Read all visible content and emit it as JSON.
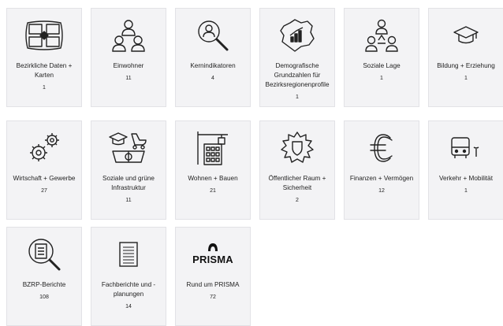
{
  "tiles": [
    {
      "label": "Bezirkliche Daten + Karten",
      "count": "1",
      "icon": "map-icon"
    },
    {
      "label": "Einwohner",
      "count": "11",
      "icon": "people-group-icon"
    },
    {
      "label": "Kernindikatoren",
      "count": "4",
      "icon": "person-search-icon"
    },
    {
      "label": "Demografische Grundzahlen für Bezirksregionenprofile",
      "count": "1",
      "icon": "district-chart-icon"
    },
    {
      "label": "Soziale Lage",
      "count": "1",
      "icon": "social-network-icon"
    },
    {
      "label": "Bildung + Erziehung",
      "count": "1",
      "icon": "graduation-cap-icon"
    },
    {
      "label": "Wirtschaft + Gewerbe",
      "count": "27",
      "icon": "gears-icon"
    },
    {
      "label": "Soziale und grüne Infrastruktur",
      "count": "11",
      "icon": "infrastructure-icon"
    },
    {
      "label": "Wohnen + Bauen",
      "count": "21",
      "icon": "building-icon"
    },
    {
      "label": "Öffentlicher Raum + Sicherheit",
      "count": "2",
      "icon": "shield-badge-icon"
    },
    {
      "label": "Finanzen + Vermögen",
      "count": "12",
      "icon": "euro-icon"
    },
    {
      "label": "Verkehr + Mobilität",
      "count": "1",
      "icon": "bus-icon"
    },
    {
      "label": "BZRP-Berichte",
      "count": "108",
      "icon": "document-search-icon"
    },
    {
      "label": "Fachberichte und -planungen",
      "count": "14",
      "icon": "document-icon"
    },
    {
      "label": "Rund um PRISMA",
      "count": "72",
      "icon": "prisma-logo-icon"
    }
  ],
  "prisma_logo_text": "PRISMA"
}
